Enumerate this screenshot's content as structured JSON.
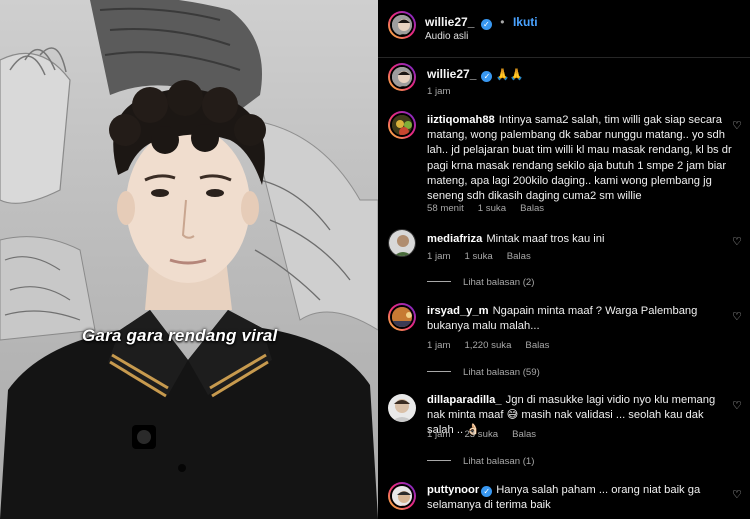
{
  "video": {
    "caption": "Gara gara rendang viral"
  },
  "post": {
    "username": "willie27_",
    "follow_label": "Ikuti",
    "audio_label": "Audio asli"
  },
  "caption_comment": {
    "username": "willie27_",
    "emoji": "🙏🙏",
    "time": "1 jam"
  },
  "comments": [
    {
      "username": "iiztiqomah88",
      "text": "Intinya sama2 salah, tim willi gak siap secara matang, wong palembang dk sabar nunggu matang.. yo sdh lah.. jd pelajaran buat tim willi kl mau masak rendang, kl bs dr pagi krna masak rendang sekilo aja butuh 1 smpe 2 jam biar mateng, apa lagi 200kilo daging.. kami wong plembang jg seneng sdh dikasih daging cuma2 sm willie",
      "time": "58 menit",
      "likes": "1 suka",
      "reply": "Balas",
      "view_replies": ""
    },
    {
      "username": "mediafriza",
      "text": "Mintak maaf tros kau ini",
      "time": "1 jam",
      "likes": "1 suka",
      "reply": "Balas",
      "view_replies": "Lihat balasan (2)"
    },
    {
      "username": "irsyad_y_m",
      "text": "Ngapain minta maaf ? Warga Palembang bukanya malu malah...",
      "time": "1 jam",
      "likes": "1,220 suka",
      "reply": "Balas",
      "view_replies": "Lihat balasan (59)"
    },
    {
      "username": "dillaparadilla_",
      "text": "Jgn di masukke lagi vidio nyo klu memang nak minta maaf 😅 masih nak validasi ... seolah kau dak salah .. 👌🏻",
      "time": "1 jam",
      "likes": "23 suka",
      "reply": "Balas",
      "view_replies": "Lihat balasan (1)"
    },
    {
      "username": "puttynoor",
      "text": "Hanya salah paham ... orang niat baik ga selamanya di terima baik",
      "time": "",
      "likes": "",
      "reply": "",
      "view_replies": ""
    }
  ],
  "colors": {
    "background": "#000000",
    "link_blue": "#4aa3ff",
    "verified_blue": "#3897f0",
    "muted_text": "#a8a8a8"
  },
  "icons": {
    "verified": "verified-badge-icon",
    "like": "heart-icon"
  }
}
